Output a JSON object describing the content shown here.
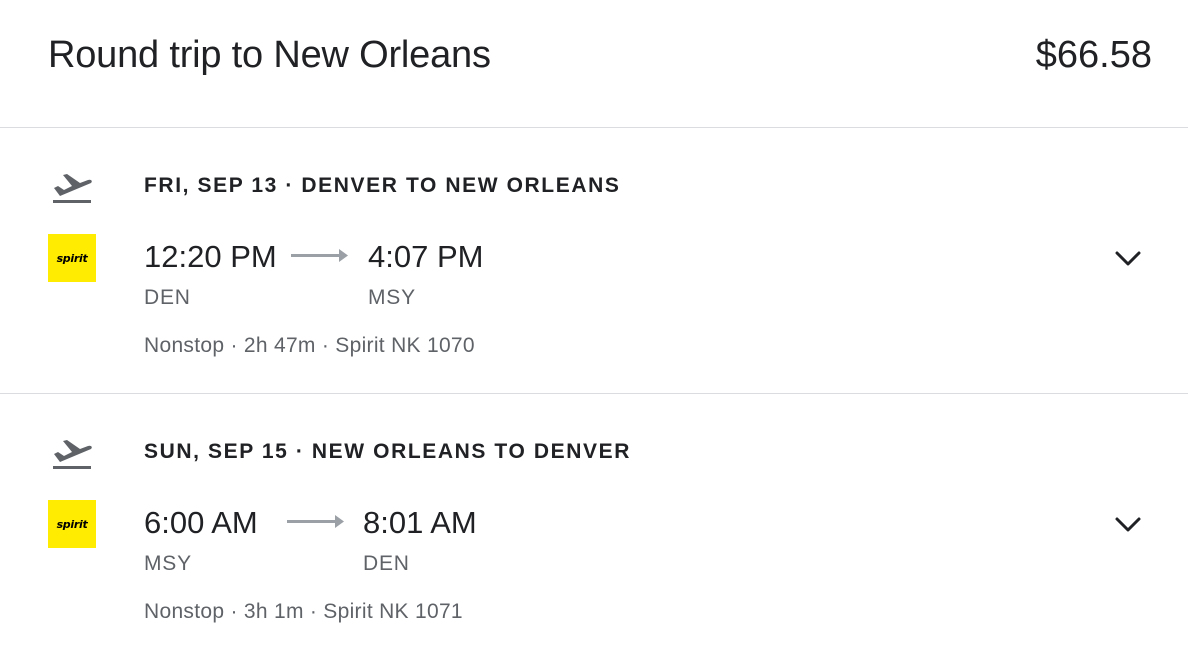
{
  "header": {
    "title": "Round trip to New Orleans",
    "price": "$66.58"
  },
  "legs": [
    {
      "heading": "Fri, Sep 13 · Denver to New Orleans",
      "airline_logo_text": "spirit",
      "depart_time": "12:20 PM",
      "arrive_time": "4:07 PM",
      "depart_airport": "DEN",
      "arrive_airport": "MSY",
      "details": "Nonstop · 2h 47m · Spirit NK 1070",
      "icon": "flight-takeoff-icon"
    },
    {
      "heading": "Sun, Sep 15 · New Orleans to Denver",
      "airline_logo_text": "spirit",
      "depart_time": "6:00 AM",
      "arrive_time": "8:01 AM",
      "depart_airport": "MSY",
      "arrive_airport": "DEN",
      "details": "Nonstop · 3h 1m · Spirit NK 1071",
      "icon": "flight-takeoff-icon"
    }
  ],
  "colors": {
    "text_primary": "#202124",
    "text_secondary": "#5f6368",
    "divider": "#dadce0",
    "spirit_yellow": "#ffec00",
    "arrow": "#9aa0a6"
  }
}
